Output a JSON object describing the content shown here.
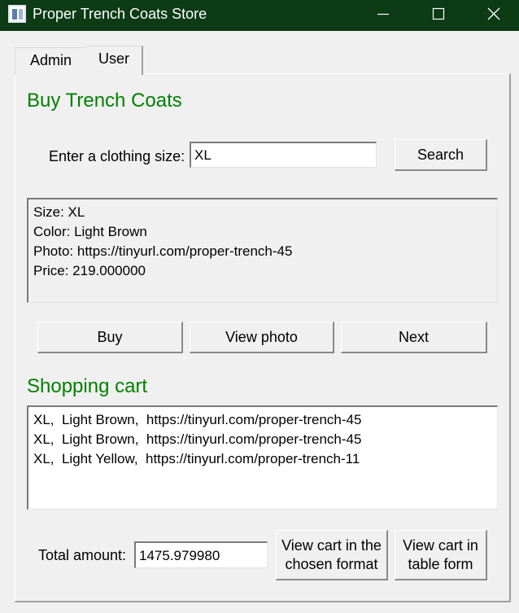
{
  "window": {
    "title": "Proper Trench Coats Store",
    "title_bar_color": "#0c3b16"
  },
  "tabs": [
    {
      "label": "Admin",
      "active": false
    },
    {
      "label": "User",
      "active": true
    }
  ],
  "buy_section": {
    "title": "Buy Trench Coats",
    "size_label": "Enter a clothing size:",
    "size_value": "XL",
    "search_label": "Search",
    "details": [
      "Size: XL",
      "Color: Light Brown",
      "Photo: https://tinyurl.com/proper-trench-45",
      "Price: 219.000000"
    ],
    "buy_label": "Buy",
    "view_photo_label": "View photo",
    "next_label": "Next"
  },
  "cart_section": {
    "title": "Shopping cart",
    "items": [
      "XL,  Light Brown,  https://tinyurl.com/proper-trench-45",
      "XL,  Light Brown,  https://tinyurl.com/proper-trench-45",
      "XL,  Light Yellow,  https://tinyurl.com/proper-trench-11"
    ],
    "total_label": "Total amount:",
    "total_value": "1475.979980",
    "view_format_label": "View cart in the\nchosen format",
    "view_table_label": "View cart in\ntable form"
  },
  "colors": {
    "section_title": "#008000"
  }
}
